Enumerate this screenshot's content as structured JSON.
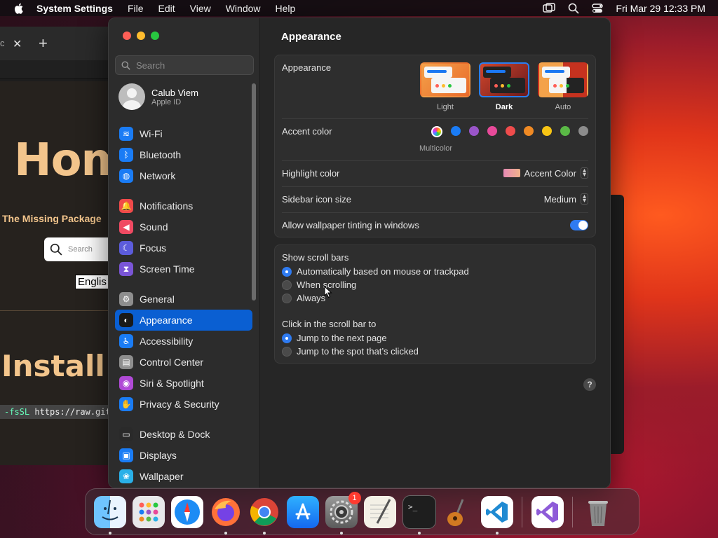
{
  "menubar": {
    "app_name": "System Settings",
    "items": [
      "File",
      "Edit",
      "View",
      "Window",
      "Help"
    ],
    "clock": "Fri Mar 29  12:33 PM"
  },
  "background_browser": {
    "tab_title": "c",
    "hero_title": "Hom",
    "subtitle": "The Missing Package",
    "search_placeholder": "Search",
    "language": "Englis",
    "install_title": "Install I",
    "code_flag": "-fsSL",
    "code_text": "https://raw.githu"
  },
  "sidebar": {
    "search_placeholder": "Search",
    "profile": {
      "name": "Calub Viem",
      "subtitle": "Apple ID"
    },
    "groups": [
      [
        {
          "label": "Wi-Fi",
          "icon": "wifi-icon",
          "color": "#1a7cf5",
          "glyph": "≋"
        },
        {
          "label": "Bluetooth",
          "icon": "bluetooth-icon",
          "color": "#1a7cf5",
          "glyph": "ᛒ"
        },
        {
          "label": "Network",
          "icon": "globe-icon",
          "color": "#1a7cf5",
          "glyph": "◍"
        }
      ],
      [
        {
          "label": "Notifications",
          "icon": "bell-icon",
          "color": "#f04a4a",
          "glyph": "🔔"
        },
        {
          "label": "Sound",
          "icon": "speaker-icon",
          "color": "#f04a62",
          "glyph": "◀"
        },
        {
          "label": "Focus",
          "icon": "moon-icon",
          "color": "#5c5cdb",
          "glyph": "☾"
        },
        {
          "label": "Screen Time",
          "icon": "hourglass-icon",
          "color": "#7a55d6",
          "glyph": "⧗"
        }
      ],
      [
        {
          "label": "General",
          "icon": "gear-icon",
          "color": "#8e8e8e",
          "glyph": "⚙"
        },
        {
          "label": "Appearance",
          "icon": "appearance-icon",
          "color": "#1a1a1a",
          "glyph": "◐",
          "selected": true
        },
        {
          "label": "Accessibility",
          "icon": "accessibility-icon",
          "color": "#1a7cf5",
          "glyph": "♿"
        },
        {
          "label": "Control Center",
          "icon": "control-center-icon",
          "color": "#8e8e8e",
          "glyph": "▤"
        },
        {
          "label": "Siri & Spotlight",
          "icon": "siri-icon",
          "color": "#b04ad6",
          "glyph": "◉"
        },
        {
          "label": "Privacy & Security",
          "icon": "hand-icon",
          "color": "#1a7cf5",
          "glyph": "✋"
        }
      ],
      [
        {
          "label": "Desktop & Dock",
          "icon": "dock-icon",
          "color": "#2a2a2a",
          "glyph": "▭"
        },
        {
          "label": "Displays",
          "icon": "display-icon",
          "color": "#1a7cf5",
          "glyph": "▣"
        },
        {
          "label": "Wallpaper",
          "icon": "wallpaper-icon",
          "color": "#2ab0e8",
          "glyph": "❀"
        }
      ]
    ]
  },
  "content": {
    "title": "Appearance",
    "appearance": {
      "label": "Appearance",
      "options": [
        {
          "label": "Light",
          "selected": false
        },
        {
          "label": "Dark",
          "selected": true
        },
        {
          "label": "Auto",
          "selected": false
        }
      ]
    },
    "accent": {
      "label": "Accent color",
      "selected_label": "Multicolor",
      "colors": [
        "multicolor",
        "#1a7cf5",
        "#9a55c9",
        "#e84a9a",
        "#ef4c4c",
        "#f08a24",
        "#f7c414",
        "#5ab946",
        "#8c8c8c"
      ]
    },
    "highlight": {
      "label": "Highlight color",
      "value": "Accent Color"
    },
    "sidebar_icon_size": {
      "label": "Sidebar icon size",
      "value": "Medium"
    },
    "wallpaper_tinting": {
      "label": "Allow wallpaper tinting in windows",
      "on": true
    },
    "scroll_bars": {
      "label": "Show scroll bars",
      "options": [
        {
          "label": "Automatically based on mouse or trackpad",
          "selected": true
        },
        {
          "label": "When scrolling",
          "selected": false
        },
        {
          "label": "Always",
          "selected": false
        }
      ]
    },
    "click_scroll": {
      "label": "Click in the scroll bar to",
      "options": [
        {
          "label": "Jump to the next page",
          "selected": true
        },
        {
          "label": "Jump to the spot that’s clicked",
          "selected": false
        }
      ]
    },
    "help": "?"
  },
  "dock": {
    "badge_system_settings": "1",
    "items": [
      "finder",
      "launchpad",
      "safari",
      "firefox",
      "chrome",
      "app-store",
      "system-settings",
      "textedit",
      "terminal",
      "garageband",
      "vscode",
      "visual-studio",
      "trash"
    ]
  }
}
